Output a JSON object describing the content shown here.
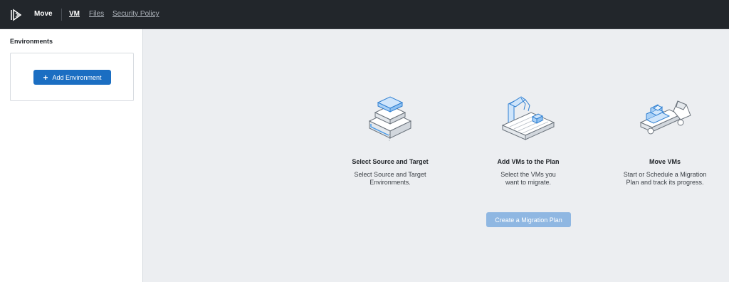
{
  "header": {
    "app_name": "Move",
    "nav": [
      {
        "label": "VM",
        "active": true
      },
      {
        "label": "Files",
        "active": false
      },
      {
        "label": "Security Policy",
        "active": false
      }
    ]
  },
  "sidebar": {
    "title": "Environments",
    "add_button_label": "Add Environment",
    "add_button_icon": "plus-icon"
  },
  "steps": [
    {
      "title": "Select Source and Target",
      "description_lines": [
        "Select Source and Target",
        "Environments."
      ],
      "icon": "servers-illustration"
    },
    {
      "title": "Add VMs to the Plan",
      "description_lines": [
        "Select the VMs you",
        "want to migrate."
      ],
      "icon": "robot-arm-conveyor-illustration"
    },
    {
      "title": "Move VMs",
      "description_lines": [
        "Start or Schedule a Migration",
        "Plan and track its progress."
      ],
      "icon": "truck-illustration"
    }
  ],
  "create_button_label": "Create a Migration Plan",
  "colors": {
    "topbar": "#22262b",
    "primary_button": "#1b6ec2",
    "disabled_button": "#8fb7e2",
    "canvas": "#eceef1"
  }
}
